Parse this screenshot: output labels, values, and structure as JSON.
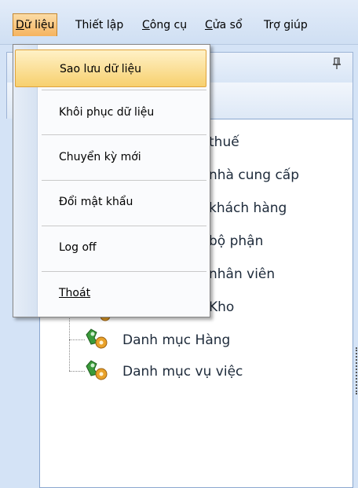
{
  "menubar": {
    "items": [
      {
        "label": "Dữ liệu",
        "mnemonic_first": "D",
        "rest": "ữ liệu"
      },
      {
        "label": "Thiết lập"
      },
      {
        "label": "Công cụ",
        "mnemonic_first": "C",
        "rest": "ông cụ"
      },
      {
        "label": "Cửa sổ",
        "mnemonic_first": "C",
        "rest": "ửa sổ"
      },
      {
        "label": "Trợ giúp"
      }
    ]
  },
  "dropdown": {
    "items": [
      {
        "label": "Sao lưu dữ liệu"
      },
      {
        "label": "Khôi phục dữ liệu"
      },
      {
        "label": "Chuyển kỳ mới"
      },
      {
        "label": "Đổi mật khẩu"
      },
      {
        "label": "Log off"
      },
      {
        "label": "Thoát"
      }
    ]
  },
  "panel": {
    "pin_glyph": "F"
  },
  "tree": {
    "items": [
      {
        "label": "thuế"
      },
      {
        "label": "nhà cung cấp"
      },
      {
        "label": "khách hàng"
      },
      {
        "label": "bộ phận"
      },
      {
        "label": "nhân viên"
      },
      {
        "label": "Kho"
      },
      {
        "label": "Danh mục Hàng"
      },
      {
        "label": "Danh mục vụ việc"
      }
    ]
  },
  "colors": {
    "menu_active": "#f5b35f",
    "hover_item": "#f7d06e",
    "panel_bg": "#d4e3f6"
  }
}
